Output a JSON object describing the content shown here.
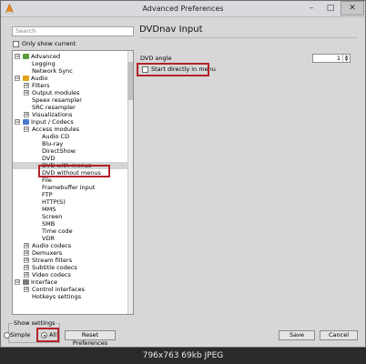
{
  "window": {
    "title": "Advanced Preferences",
    "controls": {
      "minimize": "–",
      "maximize": "□",
      "close": "✕"
    }
  },
  "left": {
    "search_placeholder": "Search",
    "only_show_current": "Only show current",
    "tree": [
      {
        "label": "Advanced",
        "level": 0,
        "expander": "⊟",
        "icon": "advanced-icon",
        "icon_color": "#5a9a3a"
      },
      {
        "label": "Logging",
        "level": 1
      },
      {
        "label": "Network Sync",
        "level": 1
      },
      {
        "label": "Audio",
        "level": 0,
        "expander": "⊟",
        "icon": "audio-icon",
        "icon_color": "#e3a21a"
      },
      {
        "label": "Filters",
        "level": 1,
        "expander": "⊞"
      },
      {
        "label": "Output modules",
        "level": 1,
        "expander": "⊞"
      },
      {
        "label": "Speex resampler",
        "level": 1
      },
      {
        "label": "SRC resampler",
        "level": 1
      },
      {
        "label": "Visualizations",
        "level": 1,
        "expander": "⊞"
      },
      {
        "label": "Input / Codecs",
        "level": 0,
        "expander": "⊟",
        "icon": "input-codecs-icon",
        "icon_color": "#4a7bd0"
      },
      {
        "label": "Access modules",
        "level": 1,
        "expander": "⊟"
      },
      {
        "label": "Audio CD",
        "level": 2
      },
      {
        "label": "Blu-ray",
        "level": 2
      },
      {
        "label": "DirectShow",
        "level": 2
      },
      {
        "label": "DVD",
        "level": 2
      },
      {
        "label": "DVD with menus",
        "level": 2,
        "selected": true
      },
      {
        "label": "DVD without menus",
        "level": 2
      },
      {
        "label": "File",
        "level": 2
      },
      {
        "label": "Framebuffer input",
        "level": 2
      },
      {
        "label": "FTP",
        "level": 2
      },
      {
        "label": "HTTP(S)",
        "level": 2
      },
      {
        "label": "MMS",
        "level": 2
      },
      {
        "label": "Screen",
        "level": 2
      },
      {
        "label": "SMB",
        "level": 2
      },
      {
        "label": "Time code",
        "level": 2
      },
      {
        "label": "VDR",
        "level": 2
      },
      {
        "label": "Audio codecs",
        "level": 1,
        "expander": "⊞"
      },
      {
        "label": "Demuxers",
        "level": 1,
        "expander": "⊞"
      },
      {
        "label": "Stream filters",
        "level": 1,
        "expander": "⊞"
      },
      {
        "label": "Subtitle codecs",
        "level": 1,
        "expander": "⊞"
      },
      {
        "label": "Video codecs",
        "level": 1,
        "expander": "⊞"
      },
      {
        "label": "Interface",
        "level": 0,
        "expander": "⊟",
        "icon": "interface-icon",
        "icon_color": "#7a7a7a"
      },
      {
        "label": "Control interfaces",
        "level": 1,
        "expander": "⊞"
      },
      {
        "label": "Hotkeys settings",
        "level": 1
      }
    ],
    "show_settings": {
      "legend": "Show settings",
      "simple": "Simple",
      "all": "All",
      "selected": "All"
    },
    "reset_button": "Reset Preferences"
  },
  "right": {
    "page_title": "DVDnav Input",
    "dvd_angle_label": "DVD angle",
    "dvd_angle_value": "1",
    "start_directly_label": "Start directly in menu",
    "start_directly_checked": false
  },
  "footer": {
    "save": "Save",
    "cancel": "Cancel"
  },
  "status_caption": "796x763 69kb JPEG",
  "colors": {
    "highlight_box": "#b3232a",
    "selected_row": "#d4d4d4"
  }
}
